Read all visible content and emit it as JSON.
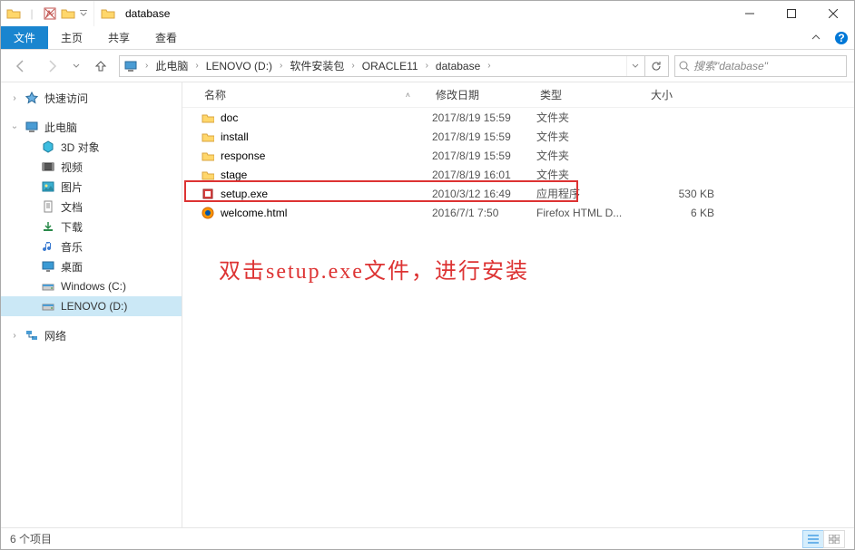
{
  "window_title": "database",
  "ribbon": {
    "file": "文件",
    "tabs": [
      "主页",
      "共享",
      "查看"
    ]
  },
  "breadcrumb": {
    "items": [
      "此电脑",
      "LENOVO (D:)",
      "软件安装包",
      "ORACLE11",
      "database"
    ]
  },
  "search": {
    "placeholder": "搜索\"database\""
  },
  "sidebar": {
    "quick_access": "快速访问",
    "this_pc": "此电脑",
    "pc_children": [
      {
        "label": "3D 对象",
        "icon": "3d"
      },
      {
        "label": "视频",
        "icon": "video"
      },
      {
        "label": "图片",
        "icon": "pictures"
      },
      {
        "label": "文档",
        "icon": "documents"
      },
      {
        "label": "下载",
        "icon": "downloads"
      },
      {
        "label": "音乐",
        "icon": "music"
      },
      {
        "label": "桌面",
        "icon": "desktop"
      },
      {
        "label": "Windows (C:)",
        "icon": "drive"
      },
      {
        "label": "LENOVO (D:)",
        "icon": "drive",
        "selected": true
      }
    ],
    "network": "网络"
  },
  "columns": {
    "name": "名称",
    "date": "修改日期",
    "type": "类型",
    "size": "大小"
  },
  "rows": [
    {
      "name": "doc",
      "date": "2017/8/19 15:59",
      "type": "文件夹",
      "icon": "folder",
      "size": ""
    },
    {
      "name": "install",
      "date": "2017/8/19 15:59",
      "type": "文件夹",
      "icon": "folder",
      "size": ""
    },
    {
      "name": "response",
      "date": "2017/8/19 15:59",
      "type": "文件夹",
      "icon": "folder",
      "size": ""
    },
    {
      "name": "stage",
      "date": "2017/8/19 16:01",
      "type": "文件夹",
      "icon": "folder",
      "size": ""
    },
    {
      "name": "setup.exe",
      "date": "2010/3/12 16:49",
      "type": "应用程序",
      "icon": "exe",
      "size": "530 KB",
      "highlighted": true
    },
    {
      "name": "welcome.html",
      "date": "2016/7/1 7:50",
      "type": "Firefox HTML D...",
      "icon": "html",
      "size": "6 KB"
    }
  ],
  "annotation": "双击setup.exe文件，进行安装",
  "status": {
    "count_label": "6 个项目"
  }
}
